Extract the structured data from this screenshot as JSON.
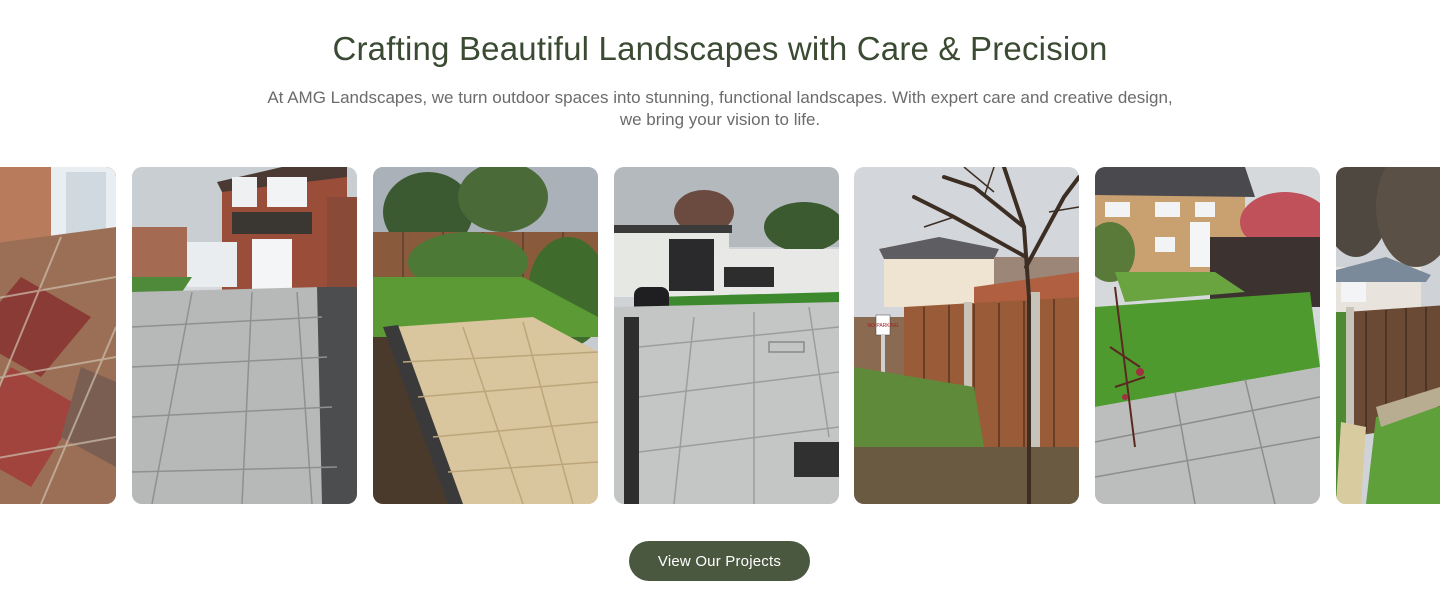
{
  "hero": {
    "title": "Crafting Beautiful Landscapes with Care & Precision",
    "subtitle": "At AMG Landscapes, we turn outdoor spaces into stunning, functional landscapes. With expert care and creative design, we bring your vision to life."
  },
  "sign": {
    "text": "NO PARKING"
  },
  "cta": {
    "label": "View Our Projects"
  },
  "colors": {
    "heading": "#3b4a32",
    "button": "#4a5840",
    "body_text": "#6b6b6b"
  }
}
